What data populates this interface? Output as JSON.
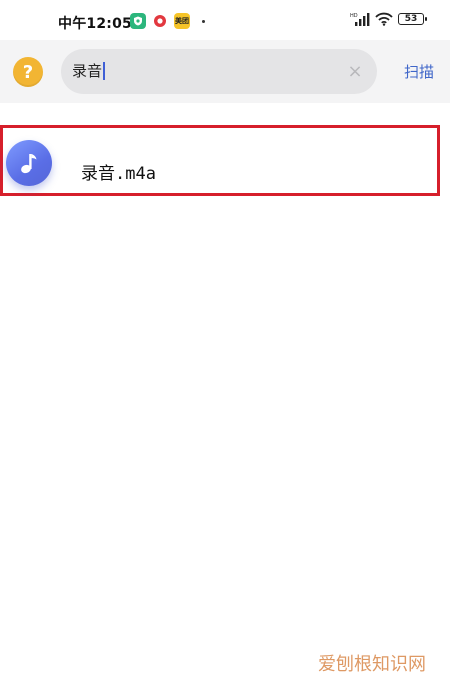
{
  "status_bar": {
    "time": "中午12:05",
    "notif_badge": "美团",
    "battery_level": "53",
    "network_label": "HD"
  },
  "search": {
    "value": "录音",
    "scan_label": "扫描",
    "help_glyph": "?",
    "clear_glyph": "×"
  },
  "results": [
    {
      "file_name": "录音.m4a",
      "icon": "music-note-icon"
    }
  ],
  "watermark": "爱刨根知识网",
  "colors": {
    "help_button": "#f2b533",
    "scan_link": "#3f66c9",
    "selection_border": "#d61f2b",
    "music_icon": "#6a7ef0"
  }
}
